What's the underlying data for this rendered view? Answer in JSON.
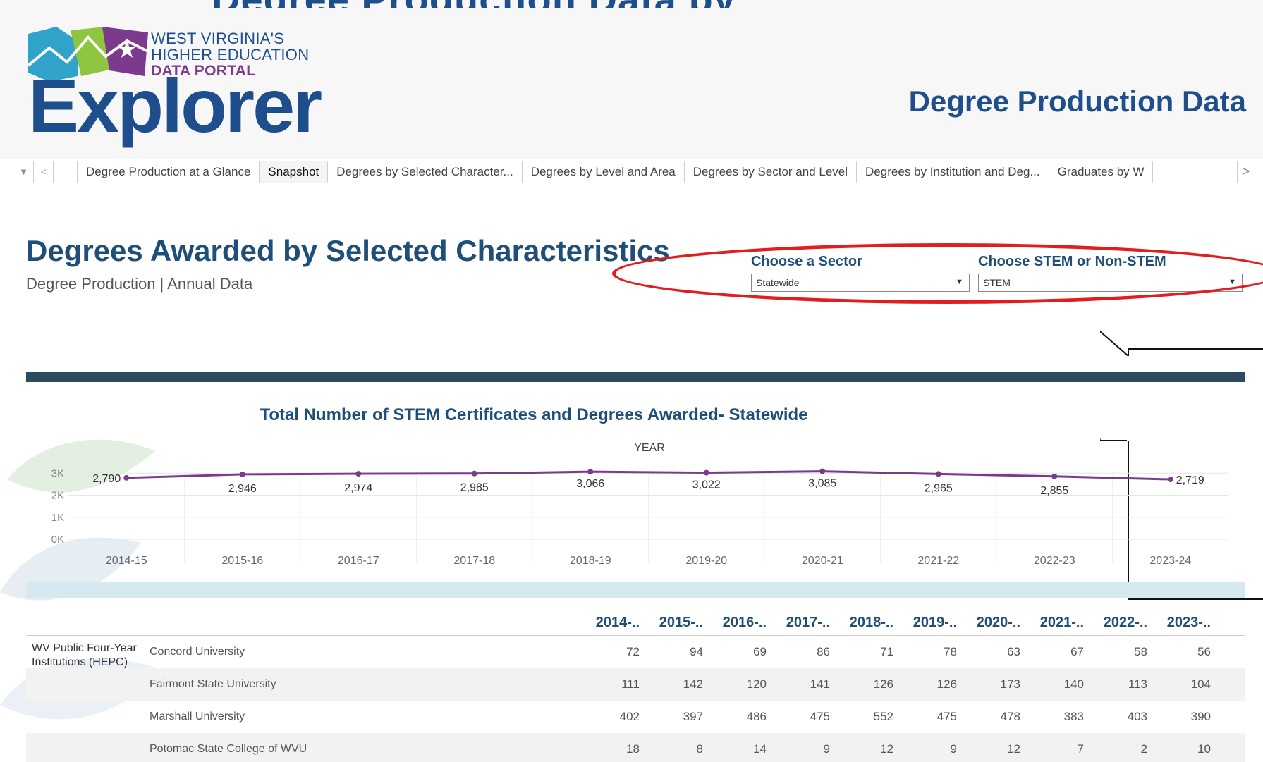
{
  "header": {
    "cut_title": "Degree Production Data by",
    "logo": {
      "line1": "WEST VIRGINIA'S",
      "line2": "HIGHER EDUCATION",
      "line3": "DATA PORTAL",
      "word": "Explorer"
    },
    "page_heading": "Degree Production Data"
  },
  "tabs": [
    {
      "label": "Degree Production at a Glance"
    },
    {
      "label": "Snapshot"
    },
    {
      "label": "Degrees by Selected Character..."
    },
    {
      "label": "Degrees by Level and Area"
    },
    {
      "label": "Degrees by Sector and Level"
    },
    {
      "label": "Degrees by Institution and Deg..."
    },
    {
      "label": "Graduates by W"
    }
  ],
  "active_tab": "Snapshot",
  "dashboard": {
    "title": "Degrees Awarded by Selected Characteristics",
    "subtitle": "Degree Production | Annual Data"
  },
  "filters": {
    "sector": {
      "label": "Choose a Sector",
      "value": "Statewide"
    },
    "stem": {
      "label": "Choose STEM or Non-STEM",
      "value": "STEM"
    }
  },
  "chart_data": {
    "type": "line",
    "title": "Total Number of STEM Certificates and Degrees Awarded- Statewide",
    "xlabel": "YEAR",
    "categories": [
      "2014-15",
      "2015-16",
      "2016-17",
      "2017-18",
      "2018-19",
      "2019-20",
      "2020-21",
      "2021-22",
      "2022-23",
      "2023-24"
    ],
    "values": [
      2790,
      2946,
      2974,
      2985,
      3066,
      3022,
      3085,
      2965,
      2855,
      2719
    ],
    "value_labels": [
      "2,790",
      "2,946",
      "2,974",
      "2,985",
      "3,066",
      "3,022",
      "3,085",
      "2,965",
      "2,855",
      "2,719"
    ],
    "y_ticks": [
      "3K",
      "2K",
      "1K",
      "0K"
    ],
    "ylim": [
      0,
      3000
    ],
    "color": "#7b3a8c"
  },
  "table": {
    "columns": [
      "2014-..",
      "2015-..",
      "2016-..",
      "2017-..",
      "2018-..",
      "2019-..",
      "2020-..",
      "2021-..",
      "2022-..",
      "2023-.."
    ],
    "group": "WV Public Four-Year Institutions (HEPC)",
    "rows": [
      {
        "institution": "Concord University",
        "values": [
          "72",
          "94",
          "69",
          "86",
          "71",
          "78",
          "63",
          "67",
          "58",
          "56"
        ]
      },
      {
        "institution": "Fairmont State University",
        "values": [
          "111",
          "142",
          "120",
          "141",
          "126",
          "126",
          "173",
          "140",
          "113",
          "104"
        ]
      },
      {
        "institution": "Marshall University",
        "values": [
          "402",
          "397",
          "486",
          "475",
          "552",
          "475",
          "478",
          "383",
          "403",
          "390"
        ]
      },
      {
        "institution": "Potomac State College of WVU",
        "values": [
          "18",
          "8",
          "14",
          "9",
          "12",
          "9",
          "12",
          "7",
          "2",
          "10"
        ]
      }
    ]
  },
  "colors": {
    "brand_blue": "#1f4e8c",
    "brand_purple": "#7b3a8c",
    "highlight_red": "#e11d1d",
    "dark_bar": "#2e4a5e"
  },
  "icons": {
    "tab_menu": "caret-down-icon",
    "tab_prev": "chevron-left-icon",
    "tab_next": "chevron-right-icon",
    "dropdown": "caret-down-icon"
  }
}
